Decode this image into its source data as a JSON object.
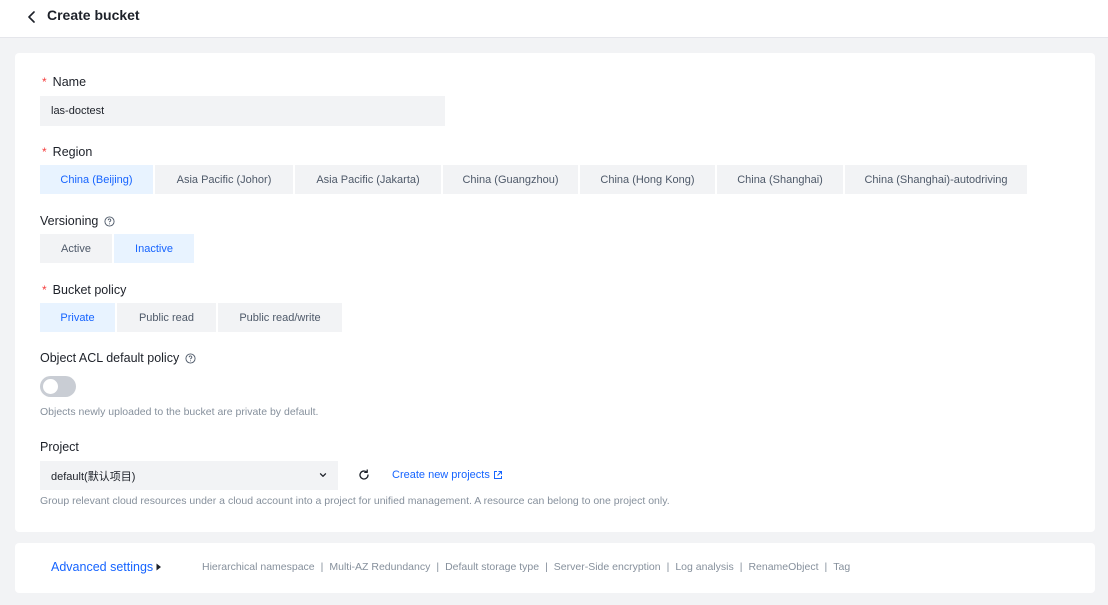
{
  "header": {
    "title": "Create bucket"
  },
  "form": {
    "name": {
      "label": "Name",
      "value": "las-doctest"
    },
    "region": {
      "label": "Region",
      "options": [
        "China (Beijing)",
        "Asia Pacific (Johor)",
        "Asia Pacific (Jakarta)",
        "China (Guangzhou)",
        "China (Hong Kong)",
        "China (Shanghai)",
        "China (Shanghai)-autodriving"
      ],
      "selected": "China (Beijing)"
    },
    "versioning": {
      "label": "Versioning",
      "options": [
        "Active",
        "Inactive"
      ],
      "selected": "Inactive"
    },
    "bucket_policy": {
      "label": "Bucket policy",
      "options": [
        "Private",
        "Public read",
        "Public read/write"
      ],
      "selected": "Private"
    },
    "acl": {
      "label": "Object ACL default policy",
      "enabled": false,
      "hint": "Objects newly uploaded to the bucket are private by default."
    },
    "project": {
      "label": "Project",
      "value": "default(默认项目)",
      "create_link": "Create new projects",
      "hint": "Group relevant cloud resources under a cloud account into a project for unified management. A resource can belong to one project only."
    }
  },
  "advanced": {
    "title": "Advanced settings",
    "items": [
      "Hierarchical namespace",
      "Multi-AZ Redundancy",
      "Default storage type",
      "Server-Side encryption",
      "Log analysis",
      "RenameObject",
      "Tag"
    ]
  },
  "colors": {
    "accent": "#1664ff",
    "required": "#f53f3f"
  }
}
